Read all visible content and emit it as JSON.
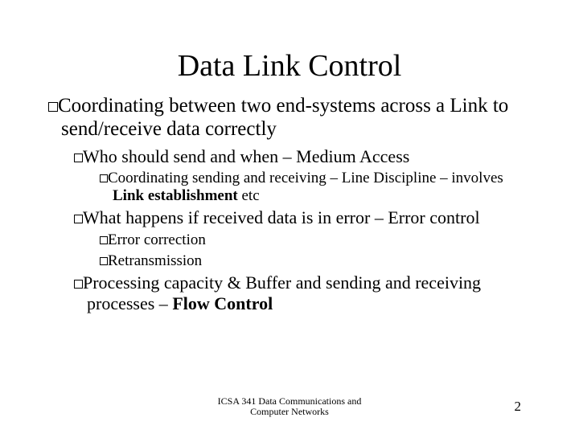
{
  "title": "Data Link Control",
  "bullets": {
    "l1": "Coordinating between two end-systems across a Link to send/receive data correctly",
    "l2a": "Who should send and when – Medium Access",
    "l3a_pre": "Coordinating sending and receiving – Line Discipline – involves ",
    "l3a_bold": "Link establishment",
    "l3a_post": " etc",
    "l2b": "What happens if received data is in error – Error control",
    "l3b": "Error correction",
    "l3c": "Retransmission",
    "l2c_pre": "Processing capacity & Buffer and sending and receiving processes – ",
    "l2c_bold": "Flow Control"
  },
  "footer": {
    "line1": "ICSA 341 Data Communications and",
    "line2": "Computer Networks"
  },
  "page_number": "2"
}
